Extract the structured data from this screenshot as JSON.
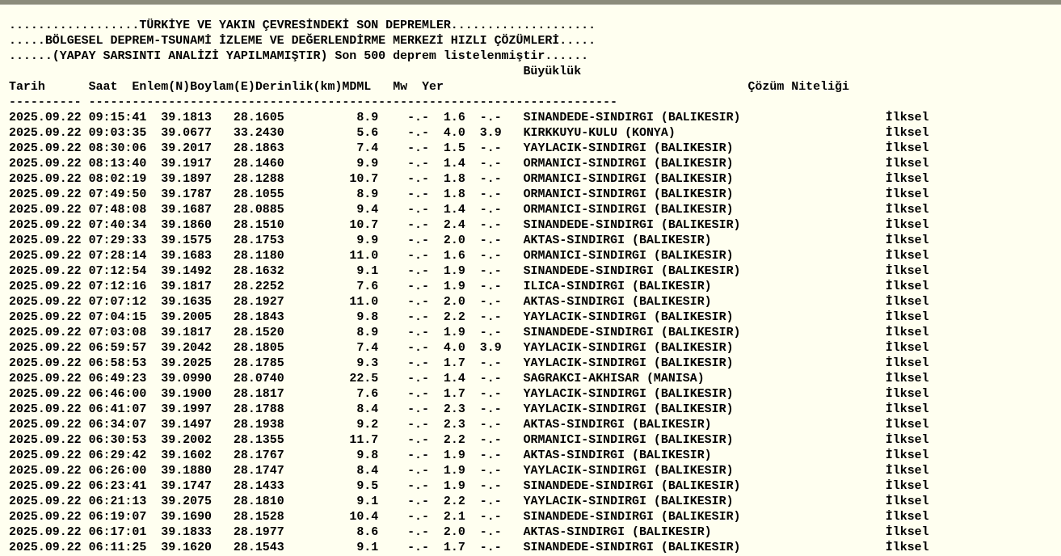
{
  "header": {
    "line1": "..................TÜRKİYE VE YAKIN ÇEVRESİNDEKİ SON DEPREMLER....................",
    "line2": ".....BÖLGESEL DEPREM-TSUNAMİ İZLEME VE DEĞERLENDİRME MERKEZİ HIZLI ÇÖZÜMLERİ.....",
    "line3": "......(YAPAY SARSINTI ANALİZİ YAPILMAMIŞTIR) Son 500 deprem listelenmiştir......"
  },
  "columns": {
    "group_label": "Büyüklük",
    "tarih": "Tarih",
    "saat": "Saat",
    "enlem": "Enlem(N)",
    "boylam": "Boylam(E)",
    "derinlik": "Derinlik(km)",
    "md": "MD",
    "ml": "ML",
    "mw": "Mw",
    "yer": "Yer",
    "cozum": "Çözüm Niteliği"
  },
  "separators": {
    "tarih": "----------",
    "saat": "--------",
    "enlem": "--------",
    "boylam": "-------",
    "derinlik": "----------",
    "mag": "------------",
    "yer": "--------------",
    "cozum": "--------------"
  },
  "rows": [
    {
      "tarih": "2025.09.22",
      "saat": "09:15:41",
      "enlem": "39.1813",
      "boylam": "28.1605",
      "derinlik": "8.9",
      "md": "-.-",
      "ml": "1.6",
      "mw": "-.-",
      "yer": "SINANDEDE-SINDIRGI (BALIKESIR)",
      "cozum": "İlksel"
    },
    {
      "tarih": "2025.09.22",
      "saat": "09:03:35",
      "enlem": "39.0677",
      "boylam": "33.2430",
      "derinlik": "5.6",
      "md": "-.-",
      "ml": "4.0",
      "mw": "3.9",
      "yer": "KIRKKUYU-KULU (KONYA)",
      "cozum": "İlksel"
    },
    {
      "tarih": "2025.09.22",
      "saat": "08:30:06",
      "enlem": "39.2017",
      "boylam": "28.1863",
      "derinlik": "7.4",
      "md": "-.-",
      "ml": "1.5",
      "mw": "-.-",
      "yer": "YAYLACIK-SINDIRGI (BALIKESIR)",
      "cozum": "İlksel"
    },
    {
      "tarih": "2025.09.22",
      "saat": "08:13:40",
      "enlem": "39.1917",
      "boylam": "28.1460",
      "derinlik": "9.9",
      "md": "-.-",
      "ml": "1.4",
      "mw": "-.-",
      "yer": "ORMANICI-SINDIRGI (BALIKESIR)",
      "cozum": "İlksel"
    },
    {
      "tarih": "2025.09.22",
      "saat": "08:02:19",
      "enlem": "39.1897",
      "boylam": "28.1288",
      "derinlik": "10.7",
      "md": "-.-",
      "ml": "1.8",
      "mw": "-.-",
      "yer": "ORMANICI-SINDIRGI (BALIKESIR)",
      "cozum": "İlksel"
    },
    {
      "tarih": "2025.09.22",
      "saat": "07:49:50",
      "enlem": "39.1787",
      "boylam": "28.1055",
      "derinlik": "8.9",
      "md": "-.-",
      "ml": "1.8",
      "mw": "-.-",
      "yer": "ORMANICI-SINDIRGI (BALIKESIR)",
      "cozum": "İlksel"
    },
    {
      "tarih": "2025.09.22",
      "saat": "07:48:08",
      "enlem": "39.1687",
      "boylam": "28.0885",
      "derinlik": "9.4",
      "md": "-.-",
      "ml": "1.4",
      "mw": "-.-",
      "yer": "ORMANICI-SINDIRGI (BALIKESIR)",
      "cozum": "İlksel"
    },
    {
      "tarih": "2025.09.22",
      "saat": "07:40:34",
      "enlem": "39.1860",
      "boylam": "28.1510",
      "derinlik": "10.7",
      "md": "-.-",
      "ml": "2.4",
      "mw": "-.-",
      "yer": "SINANDEDE-SINDIRGI (BALIKESIR)",
      "cozum": "İlksel"
    },
    {
      "tarih": "2025.09.22",
      "saat": "07:29:33",
      "enlem": "39.1575",
      "boylam": "28.1753",
      "derinlik": "9.9",
      "md": "-.-",
      "ml": "2.0",
      "mw": "-.-",
      "yer": "AKTAS-SINDIRGI (BALIKESIR)",
      "cozum": "İlksel"
    },
    {
      "tarih": "2025.09.22",
      "saat": "07:28:14",
      "enlem": "39.1683",
      "boylam": "28.1180",
      "derinlik": "11.0",
      "md": "-.-",
      "ml": "1.6",
      "mw": "-.-",
      "yer": "ORMANICI-SINDIRGI (BALIKESIR)",
      "cozum": "İlksel"
    },
    {
      "tarih": "2025.09.22",
      "saat": "07:12:54",
      "enlem": "39.1492",
      "boylam": "28.1632",
      "derinlik": "9.1",
      "md": "-.-",
      "ml": "1.9",
      "mw": "-.-",
      "yer": "SINANDEDE-SINDIRGI (BALIKESIR)",
      "cozum": "İlksel"
    },
    {
      "tarih": "2025.09.22",
      "saat": "07:12:16",
      "enlem": "39.1817",
      "boylam": "28.2252",
      "derinlik": "7.6",
      "md": "-.-",
      "ml": "1.9",
      "mw": "-.-",
      "yer": "ILICA-SINDIRGI (BALIKESIR)",
      "cozum": "İlksel"
    },
    {
      "tarih": "2025.09.22",
      "saat": "07:07:12",
      "enlem": "39.1635",
      "boylam": "28.1927",
      "derinlik": "11.0",
      "md": "-.-",
      "ml": "2.0",
      "mw": "-.-",
      "yer": "AKTAS-SINDIRGI (BALIKESIR)",
      "cozum": "İlksel"
    },
    {
      "tarih": "2025.09.22",
      "saat": "07:04:15",
      "enlem": "39.2005",
      "boylam": "28.1843",
      "derinlik": "9.8",
      "md": "-.-",
      "ml": "2.2",
      "mw": "-.-",
      "yer": "YAYLACIK-SINDIRGI (BALIKESIR)",
      "cozum": "İlksel"
    },
    {
      "tarih": "2025.09.22",
      "saat": "07:03:08",
      "enlem": "39.1817",
      "boylam": "28.1520",
      "derinlik": "8.9",
      "md": "-.-",
      "ml": "1.9",
      "mw": "-.-",
      "yer": "SINANDEDE-SINDIRGI (BALIKESIR)",
      "cozum": "İlksel"
    },
    {
      "tarih": "2025.09.22",
      "saat": "06:59:57",
      "enlem": "39.2042",
      "boylam": "28.1805",
      "derinlik": "7.4",
      "md": "-.-",
      "ml": "4.0",
      "mw": "3.9",
      "yer": "YAYLACIK-SINDIRGI (BALIKESIR)",
      "cozum": "İlksel"
    },
    {
      "tarih": "2025.09.22",
      "saat": "06:58:53",
      "enlem": "39.2025",
      "boylam": "28.1785",
      "derinlik": "9.3",
      "md": "-.-",
      "ml": "1.7",
      "mw": "-.-",
      "yer": "YAYLACIK-SINDIRGI (BALIKESIR)",
      "cozum": "İlksel"
    },
    {
      "tarih": "2025.09.22",
      "saat": "06:49:23",
      "enlem": "39.0990",
      "boylam": "28.0740",
      "derinlik": "22.5",
      "md": "-.-",
      "ml": "1.4",
      "mw": "-.-",
      "yer": "SAGRAKCI-AKHISAR (MANISA)",
      "cozum": "İlksel"
    },
    {
      "tarih": "2025.09.22",
      "saat": "06:46:00",
      "enlem": "39.1900",
      "boylam": "28.1817",
      "derinlik": "7.6",
      "md": "-.-",
      "ml": "1.7",
      "mw": "-.-",
      "yer": "YAYLACIK-SINDIRGI (BALIKESIR)",
      "cozum": "İlksel"
    },
    {
      "tarih": "2025.09.22",
      "saat": "06:41:07",
      "enlem": "39.1997",
      "boylam": "28.1788",
      "derinlik": "8.4",
      "md": "-.-",
      "ml": "2.3",
      "mw": "-.-",
      "yer": "YAYLACIK-SINDIRGI (BALIKESIR)",
      "cozum": "İlksel"
    },
    {
      "tarih": "2025.09.22",
      "saat": "06:34:07",
      "enlem": "39.1497",
      "boylam": "28.1938",
      "derinlik": "9.2",
      "md": "-.-",
      "ml": "2.3",
      "mw": "-.-",
      "yer": "AKTAS-SINDIRGI (BALIKESIR)",
      "cozum": "İlksel"
    },
    {
      "tarih": "2025.09.22",
      "saat": "06:30:53",
      "enlem": "39.2002",
      "boylam": "28.1355",
      "derinlik": "11.7",
      "md": "-.-",
      "ml": "2.2",
      "mw": "-.-",
      "yer": "ORMANICI-SINDIRGI (BALIKESIR)",
      "cozum": "İlksel"
    },
    {
      "tarih": "2025.09.22",
      "saat": "06:29:42",
      "enlem": "39.1602",
      "boylam": "28.1767",
      "derinlik": "9.8",
      "md": "-.-",
      "ml": "1.9",
      "mw": "-.-",
      "yer": "AKTAS-SINDIRGI (BALIKESIR)",
      "cozum": "İlksel"
    },
    {
      "tarih": "2025.09.22",
      "saat": "06:26:00",
      "enlem": "39.1880",
      "boylam": "28.1747",
      "derinlik": "8.4",
      "md": "-.-",
      "ml": "1.9",
      "mw": "-.-",
      "yer": "YAYLACIK-SINDIRGI (BALIKESIR)",
      "cozum": "İlksel"
    },
    {
      "tarih": "2025.09.22",
      "saat": "06:23:41",
      "enlem": "39.1747",
      "boylam": "28.1433",
      "derinlik": "9.5",
      "md": "-.-",
      "ml": "1.9",
      "mw": "-.-",
      "yer": "SINANDEDE-SINDIRGI (BALIKESIR)",
      "cozum": "İlksel"
    },
    {
      "tarih": "2025.09.22",
      "saat": "06:21:13",
      "enlem": "39.2075",
      "boylam": "28.1810",
      "derinlik": "9.1",
      "md": "-.-",
      "ml": "2.2",
      "mw": "-.-",
      "yer": "YAYLACIK-SINDIRGI (BALIKESIR)",
      "cozum": "İlksel"
    },
    {
      "tarih": "2025.09.22",
      "saat": "06:19:07",
      "enlem": "39.1690",
      "boylam": "28.1528",
      "derinlik": "10.4",
      "md": "-.-",
      "ml": "2.1",
      "mw": "-.-",
      "yer": "SINANDEDE-SINDIRGI (BALIKESIR)",
      "cozum": "İlksel"
    },
    {
      "tarih": "2025.09.22",
      "saat": "06:17:01",
      "enlem": "39.1833",
      "boylam": "28.1977",
      "derinlik": "8.6",
      "md": "-.-",
      "ml": "2.0",
      "mw": "-.-",
      "yer": "AKTAS-SINDIRGI (BALIKESIR)",
      "cozum": "İlksel"
    },
    {
      "tarih": "2025.09.22",
      "saat": "06:11:25",
      "enlem": "39.1620",
      "boylam": "28.1543",
      "derinlik": "9.1",
      "md": "-.-",
      "ml": "1.7",
      "mw": "-.-",
      "yer": "SINANDEDE-SINDIRGI (BALIKESIR)",
      "cozum": "İlksel"
    }
  ]
}
